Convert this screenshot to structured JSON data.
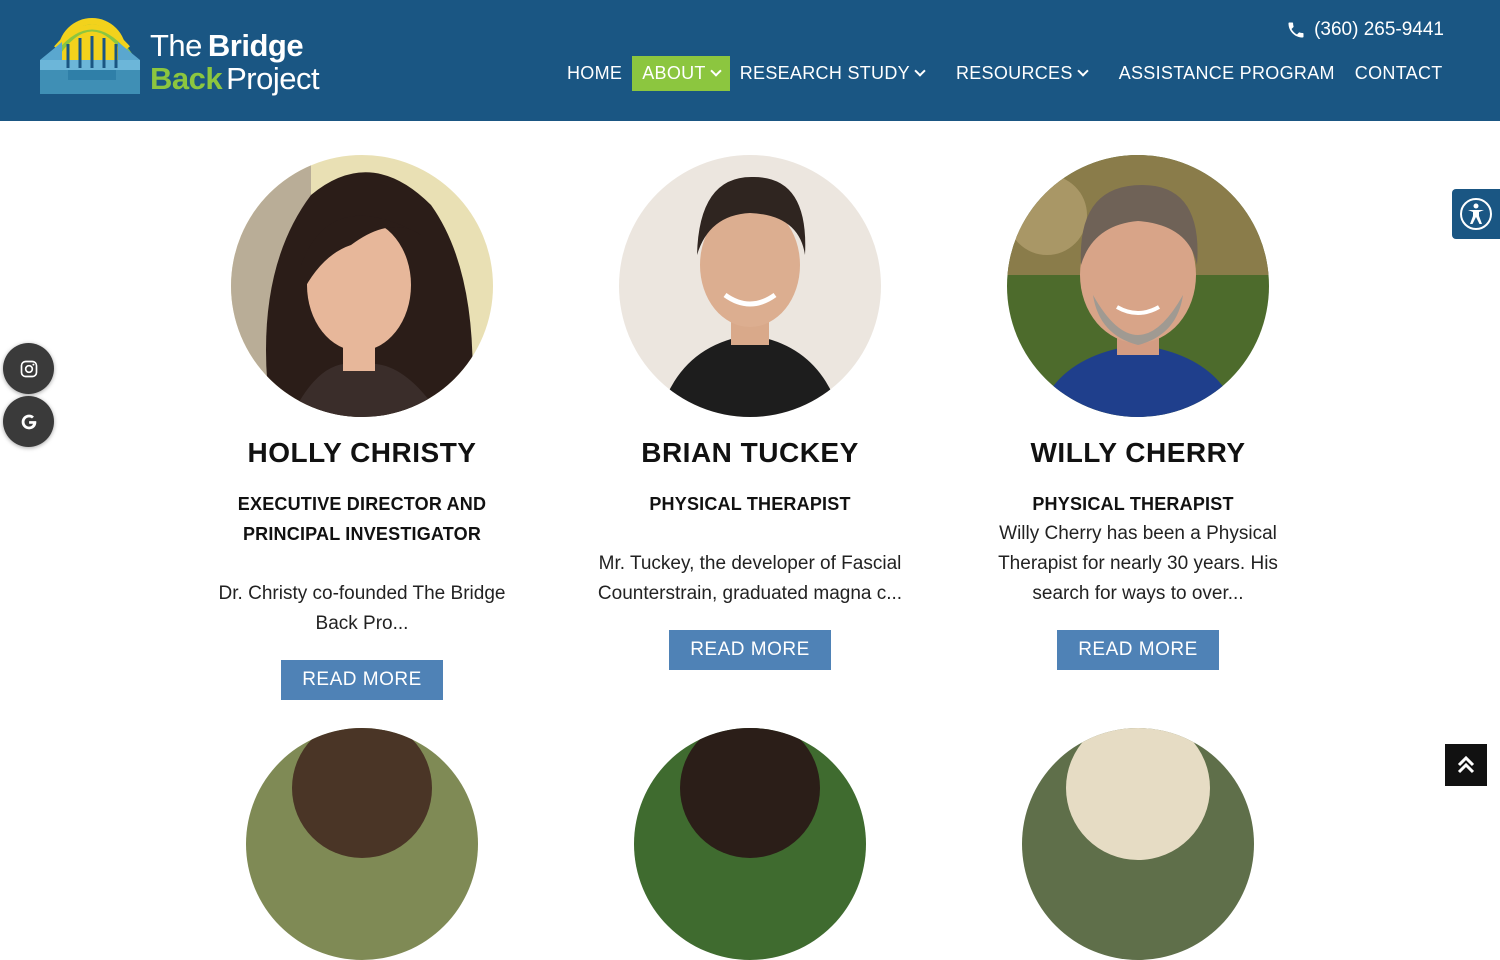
{
  "header": {
    "logo": {
      "line1_bold": "The",
      "line1_rest": "Bridge",
      "line2_bold": "Back",
      "line2_rest": "Project"
    },
    "phone": "(360) 265-9441",
    "nav": [
      {
        "label": "HOME",
        "dropdown": false,
        "active": false
      },
      {
        "label": "ABOUT",
        "dropdown": true,
        "active": true
      },
      {
        "label": "RESEARCH STUDY",
        "dropdown": true,
        "active": false
      },
      {
        "label": "RESOURCES",
        "dropdown": true,
        "active": false
      },
      {
        "label": "ASSISTANCE PROGRAM",
        "dropdown": false,
        "active": false
      },
      {
        "label": "CONTACT",
        "dropdown": false,
        "active": false
      }
    ]
  },
  "team": [
    {
      "name": "HOLLY CHRISTY",
      "role_line1": "EXECUTIVE DIRECTOR AND",
      "role_line2": "PRINCIPAL INVESTIGATOR",
      "desc_line1": "Dr. Christy co-founded The Bridge",
      "desc_line2": "Back Pro...",
      "button": "READ MORE"
    },
    {
      "name": "BRIAN TUCKEY",
      "role_line1": "PHYSICAL THERAPIST",
      "desc_line1": "Mr. Tuckey, the developer of Fascial",
      "desc_line2": "Counterstrain, graduated magna c...",
      "button": "READ MORE"
    },
    {
      "name": "WILLY CHERRY",
      "role_line1": "PHYSICAL THERAPIST",
      "desc_line1": "Willy Cherry has been a Physical",
      "desc_line2": "Therapist for nearly 30 years. His",
      "desc_line3": "search for ways to over...",
      "button": "READ MORE"
    }
  ],
  "widgets": {
    "social": [
      "instagram-icon",
      "google-icon"
    ],
    "accessibility": "accessibility-icon",
    "scroll_top": "double-chevron-up-icon"
  },
  "colors": {
    "header_bg": "#1a5683",
    "nav_active": "#8cc63f",
    "button_bg": "#4f82b6",
    "logo_green": "#8cc63f"
  }
}
